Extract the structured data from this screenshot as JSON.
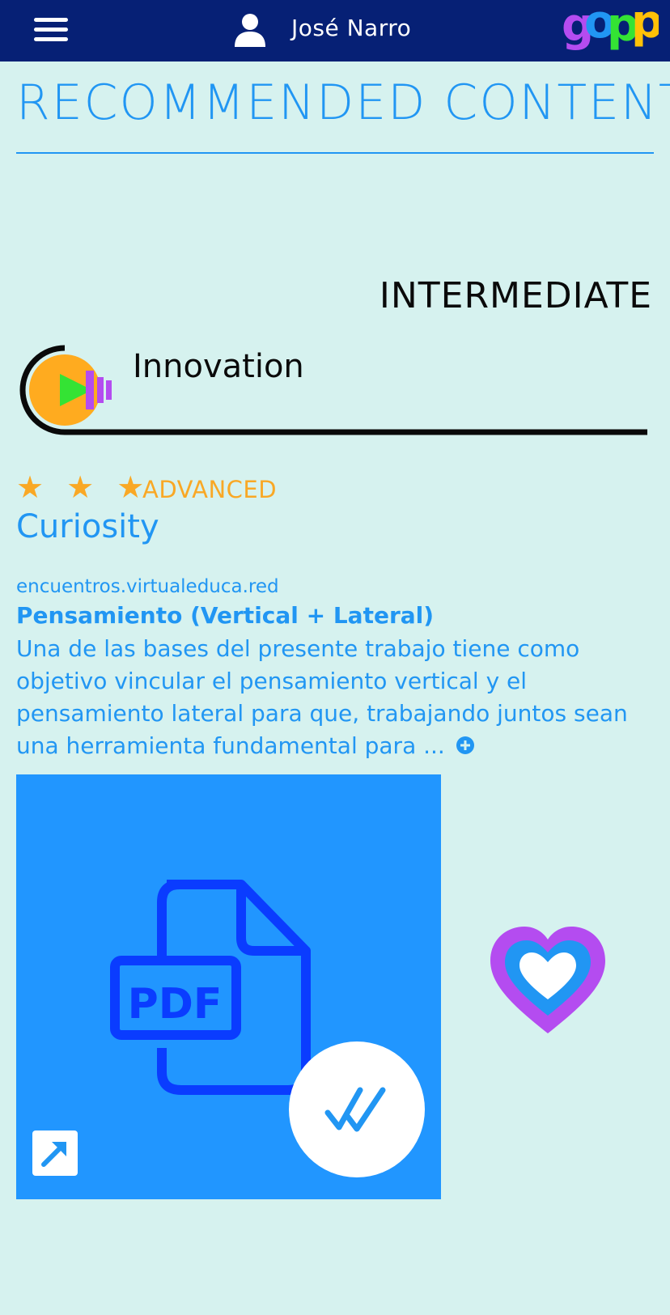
{
  "header": {
    "user_name": "José Narro",
    "logo_text": "gopp",
    "menu_icon": "hamburger-menu-icon",
    "user_icon": "user-icon"
  },
  "page": {
    "title": "RECOMMENDED CONTENT"
  },
  "skill": {
    "level": "INTERMEDIATE",
    "name": "Innovation"
  },
  "recommendation": {
    "stars": "★ ★ ★",
    "star_count": 3,
    "level": "ADVANCED",
    "sub_skill": "Curiosity",
    "source": "encuentros.virtualeduca.red",
    "title": "Pensamiento (Vertical + Lateral)",
    "description": "Una de las bases del presente trabajo tiene como objetivo vincular el pensamiento vertical y el pensamiento lateral para que, trabajando juntos sean una herramienta fundamental para ...",
    "more_icon": "plus-circle-icon"
  },
  "card": {
    "type_label": "PDF",
    "type_icon": "pdf-file-icon",
    "status_icon": "double-check-icon",
    "open_icon": "external-link-icon"
  },
  "favorite": {
    "icon": "heart-icon"
  },
  "colors": {
    "header_bg": "#062075",
    "background": "#d6f2ef",
    "accent": "#2196f3",
    "star": "#f9a825",
    "card_bg": "#2196ff",
    "pdf_stroke": "#0a3cff",
    "heart_outer": "#b44cf0"
  }
}
